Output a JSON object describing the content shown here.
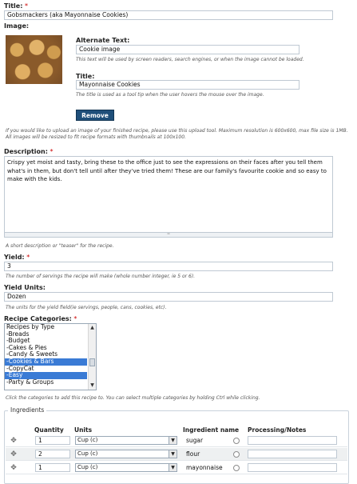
{
  "title_field": {
    "label": "Title:",
    "required": "*",
    "value": "Gobsmackers (aka Mayonnaise Cookies)"
  },
  "image_field": {
    "label": "Image:",
    "alt_text": {
      "label": "Alternate Text:",
      "value": "Cookie image",
      "help": "This text will be used by screen readers, search engines, or when the image cannot be loaded."
    },
    "title": {
      "label": "Title:",
      "value": "Mayonnaise Cookies",
      "help": "The title is used as a tool tip when the user hovers the mouse over the image."
    },
    "remove_label": "Remove",
    "upload_help": "If you would like to upload an image of your finished recipe, please use this upload tool. Maximum resolution is 600x600, max file size is 1MB. All images will be resized to fit recipe formats with thumbnails at 100x100."
  },
  "description_field": {
    "label": "Description:",
    "required": "*",
    "value": "Crispy yet moist and tasty, bring these to the office just to see the expressions on their faces after you tell them what's in them, but don't tell until after they've tried them! These are our family's favourite cookie and so easy to make with the kids.",
    "help": "A short description or \"teaser\" for the recipe."
  },
  "yield_field": {
    "label": "Yield:",
    "required": "*",
    "value": "3",
    "help": "The number of servings the recipe will make (whole number integer, ie 5 or 6)."
  },
  "yield_units_field": {
    "label": "Yield Units:",
    "value": "Dozen",
    "help": "The units for the yield field(ie servings, people, cans, cookies, etc)."
  },
  "categories_field": {
    "label": "Recipe Categories:",
    "required": "*",
    "options": [
      {
        "label": "Recipes by Type",
        "selected": false
      },
      {
        "label": "-Breads",
        "selected": false
      },
      {
        "label": "-Budget",
        "selected": false
      },
      {
        "label": "-Cakes & Pies",
        "selected": false
      },
      {
        "label": "-Candy & Sweets",
        "selected": false
      },
      {
        "label": "-Cookies & Bars",
        "selected": true
      },
      {
        "label": "-CopyCat",
        "selected": false
      },
      {
        "label": "-Easy",
        "selected": true
      },
      {
        "label": "-Party & Groups",
        "selected": false
      }
    ],
    "help": "Click the categories to add this recipe to. You can select multiple categories by holding Ctrl while clicking."
  },
  "ingredients": {
    "legend": "Ingredients",
    "headers": {
      "quantity": "Quantity",
      "units": "Units",
      "name": "Ingredient name",
      "notes": "Processing/Notes"
    },
    "rows": [
      {
        "quantity": "1",
        "unit": "Cup (c)",
        "name": "sugar",
        "notes": ""
      },
      {
        "quantity": "2",
        "unit": "Cup (c)",
        "name": "flour",
        "notes": ""
      },
      {
        "quantity": "1",
        "unit": "Cup (c)",
        "name": "mayonnaise",
        "notes": ""
      }
    ]
  },
  "colors": {
    "required": "#cc0000",
    "button": "#1f4f7a",
    "selection": "#3a7bd5"
  }
}
